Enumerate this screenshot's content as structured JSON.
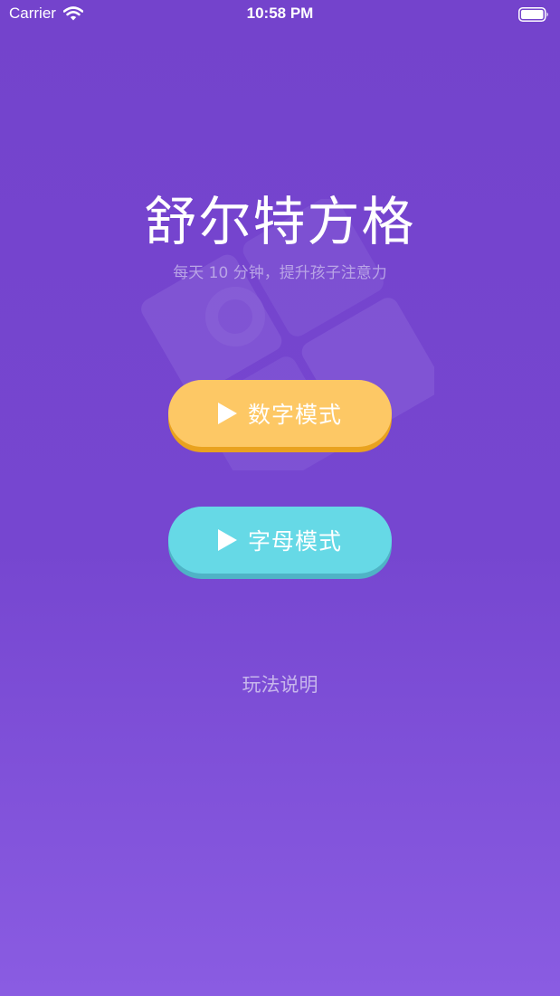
{
  "status_bar": {
    "carrier": "Carrier",
    "time": "10:58 PM"
  },
  "main": {
    "title": "舒尔特方格",
    "subtitle": "每天 10 分钟，提升孩子注意力",
    "number_mode_label": "数字模式",
    "letter_mode_label": "字母模式",
    "instructions_link": "玩法说明"
  },
  "colors": {
    "background_top": "#7443cc",
    "background_bottom": "#8a5ce2",
    "number_button": "#fdc865",
    "number_button_shadow": "#e9a21f",
    "letter_button": "#66d9e6",
    "letter_button_shadow": "#4fb3c6"
  },
  "icons": {
    "wifi": "wifi-icon",
    "battery": "battery-icon",
    "play": "play-icon"
  }
}
